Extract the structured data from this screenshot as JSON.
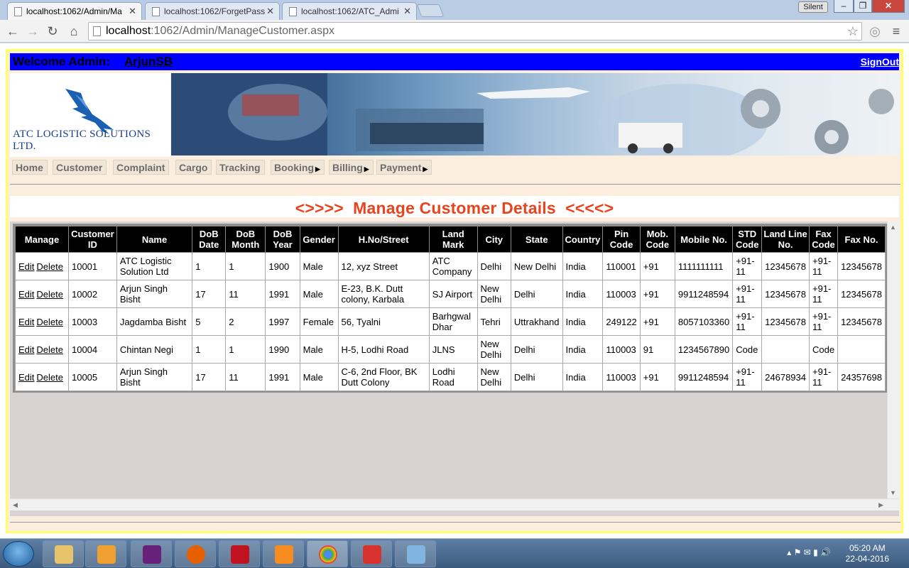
{
  "browser": {
    "tabs": [
      {
        "title": "localhost:1062/Admin/Ma",
        "active": true
      },
      {
        "title": "localhost:1062/ForgetPass",
        "active": false
      },
      {
        "title": "localhost:1062/ATC_Admi",
        "active": false
      }
    ],
    "profile_label": "Silent",
    "address": {
      "host": "localhost",
      "path": ":1062/Admin/ManageCustomer.aspx"
    }
  },
  "header": {
    "welcome_label": "Welcome Admin:",
    "username": "ArjunSB",
    "signout_label": "SignOut",
    "company_name": "ATC LOGISTIC SOLUTIONS LTD."
  },
  "menu": [
    {
      "label": "Home",
      "has_submenu": false
    },
    {
      "label": "Customer",
      "has_submenu": false
    },
    {
      "label": "Complaint",
      "has_submenu": false
    },
    {
      "label": "Cargo",
      "has_submenu": false
    },
    {
      "label": "Tracking",
      "has_submenu": false
    },
    {
      "label": "Booking",
      "has_submenu": true
    },
    {
      "label": "Billing",
      "has_submenu": true
    },
    {
      "label": "Payment",
      "has_submenu": true
    }
  ],
  "page_title": "<>>>>  Manage Customer Details  <<<<>",
  "grid": {
    "columns": [
      "Manage",
      "Customer ID",
      "Name",
      "DoB Date",
      "DoB Month",
      "DoB Year",
      "Gender",
      "H.No/Street",
      "Land Mark",
      "City",
      "State",
      "Country",
      "Pin Code",
      "Mob. Code",
      "Mobile No.",
      "STD Code",
      "Land Line No.",
      "Fax Code",
      "Fax No."
    ],
    "edit_label": "Edit",
    "delete_label": "Delete",
    "rows": [
      {
        "id": "10001",
        "name": "ATC Logistic Solution Ltd",
        "dob_date": "1",
        "dob_month": "1",
        "dob_year": "1900",
        "gender": "Male",
        "street": "12, xyz Street",
        "landmark": "ATC Company",
        "city": "Delhi",
        "state": "New Delhi",
        "country": "India",
        "pin": "110001",
        "mob_code": "+91",
        "mobile": "1111111111",
        "std_code": "+91-11",
        "landline": "12345678",
        "fax_code": "+91-11",
        "fax": "12345678"
      },
      {
        "id": "10002",
        "name": "Arjun Singh Bisht",
        "dob_date": "17",
        "dob_month": "11",
        "dob_year": "1991",
        "gender": "Male",
        "street": "E-23, B.K. Dutt colony, Karbala",
        "landmark": "SJ Airport",
        "city": "New Delhi",
        "state": "Delhi",
        "country": "India",
        "pin": "110003",
        "mob_code": "+91",
        "mobile": "9911248594",
        "std_code": "+91-11",
        "landline": "12345678",
        "fax_code": "+91-11",
        "fax": "12345678"
      },
      {
        "id": "10003",
        "name": "Jagdamba Bisht",
        "dob_date": "5",
        "dob_month": "2",
        "dob_year": "1997",
        "gender": "Female",
        "street": "56, Tyalni",
        "landmark": "Barhgwal Dhar",
        "city": "Tehri",
        "state": "Uttrakhand",
        "country": "India",
        "pin": "249122",
        "mob_code": "+91",
        "mobile": "8057103360",
        "std_code": "+91-11",
        "landline": "12345678",
        "fax_code": "+91-11",
        "fax": "12345678"
      },
      {
        "id": "10004",
        "name": "Chintan Negi",
        "dob_date": "1",
        "dob_month": "1",
        "dob_year": "1990",
        "gender": "Male",
        "street": "H-5, Lodhi Road",
        "landmark": "JLNS",
        "city": "New Delhi",
        "state": "Delhi",
        "country": "India",
        "pin": "110003",
        "mob_code": "91",
        "mobile": "1234567890",
        "std_code": "Code",
        "landline": "",
        "fax_code": "Code",
        "fax": ""
      },
      {
        "id": "10005",
        "name": "Arjun Singh Bisht",
        "dob_date": "17",
        "dob_month": "11",
        "dob_year": "1991",
        "gender": "Male",
        "street": "C-6, 2nd Floor, BK Dutt Colony",
        "landmark": "Lodhi Road",
        "city": "New Delhi",
        "state": "Delhi",
        "country": "India",
        "pin": "110003",
        "mob_code": "+91",
        "mobile": "9911248594",
        "std_code": "+91-11",
        "landline": "24678934",
        "fax_code": "+91-11",
        "fax": "24357698"
      }
    ]
  },
  "taskbar": {
    "time": "05:20 AM",
    "date": "22-04-2016",
    "apps": [
      "explorer-icon",
      "media-player-icon",
      "visual-studio-icon",
      "firefox-icon",
      "acrobat-icon",
      "vlc-icon",
      "chrome-icon",
      "ccleaner-icon",
      "paint-icon"
    ]
  },
  "colors": {
    "welcome_bar": "#0000ff",
    "title": "#e8441f",
    "grid_header": "#000000",
    "frame_border": "#ffff66"
  }
}
